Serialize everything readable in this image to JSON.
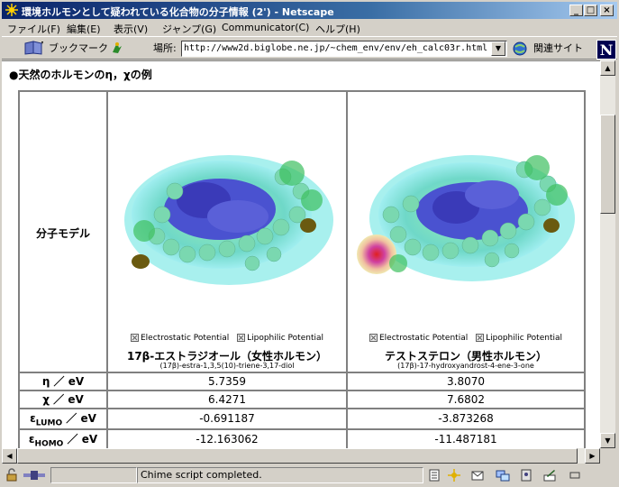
{
  "window": {
    "title": "環境ホルモンとして疑われている化合物の分子情報 (2') - Netscape",
    "minimize": "_",
    "maximize": "□",
    "close": "×"
  },
  "menu": [
    "ファイル(F)",
    "編集(E)",
    "表示(V)",
    "ジャンプ(G)",
    "Communicator(C)",
    "ヘルプ(H)"
  ],
  "toolbar": {
    "bookmarks_label": "ブックマーク",
    "location_label": "場所:",
    "url": "http://www2d.biglobe.ne.jp/~chem_env/env/eh_calc03r.html",
    "related_label": "関連サイト",
    "logo": "N"
  },
  "page": {
    "heading": "●天然のホルモンのη，χの例",
    "row_label_model": "分子モデル",
    "checkbox_electrostatic": "Electrostatic Potential",
    "checkbox_lipophilic": "Lipophilic Potential",
    "compounds": [
      {
        "name": "17β-エストラジオール（女性ホルモン）",
        "systematic": "(17β)-estra-1,3,5(10)-triene-3,17-diol"
      },
      {
        "name": "テストステロン（男性ホルモン）",
        "systematic": "(17β)-17-hydroxyandrost-4-ene-3-one"
      }
    ],
    "rows": [
      {
        "label_symbol": "η",
        "label_sub": "",
        "label_unit": " ／ eV",
        "values": [
          "5.7359",
          "3.8070"
        ]
      },
      {
        "label_symbol": "χ",
        "label_sub": "",
        "label_unit": " ／ eV",
        "values": [
          "6.4271",
          "7.6802"
        ]
      },
      {
        "label_symbol": "ε",
        "label_sub": "LUMO",
        "label_unit": " ／ eV",
        "values": [
          "-0.691187",
          "-3.873268"
        ]
      },
      {
        "label_symbol": "ε",
        "label_sub": "HOMO",
        "label_unit": " ／ eV",
        "values": [
          "-12.163062",
          "-11.487181"
        ]
      }
    ]
  },
  "status": {
    "text": "Chime script completed."
  },
  "colors": {
    "titlebar_start": "#0a246a",
    "surface_cyan": "#7fe0d8",
    "carbon_blue": "#3a3ad0",
    "oxygen_olive": "#5a5a10",
    "hotspot_red": "#e02020"
  }
}
